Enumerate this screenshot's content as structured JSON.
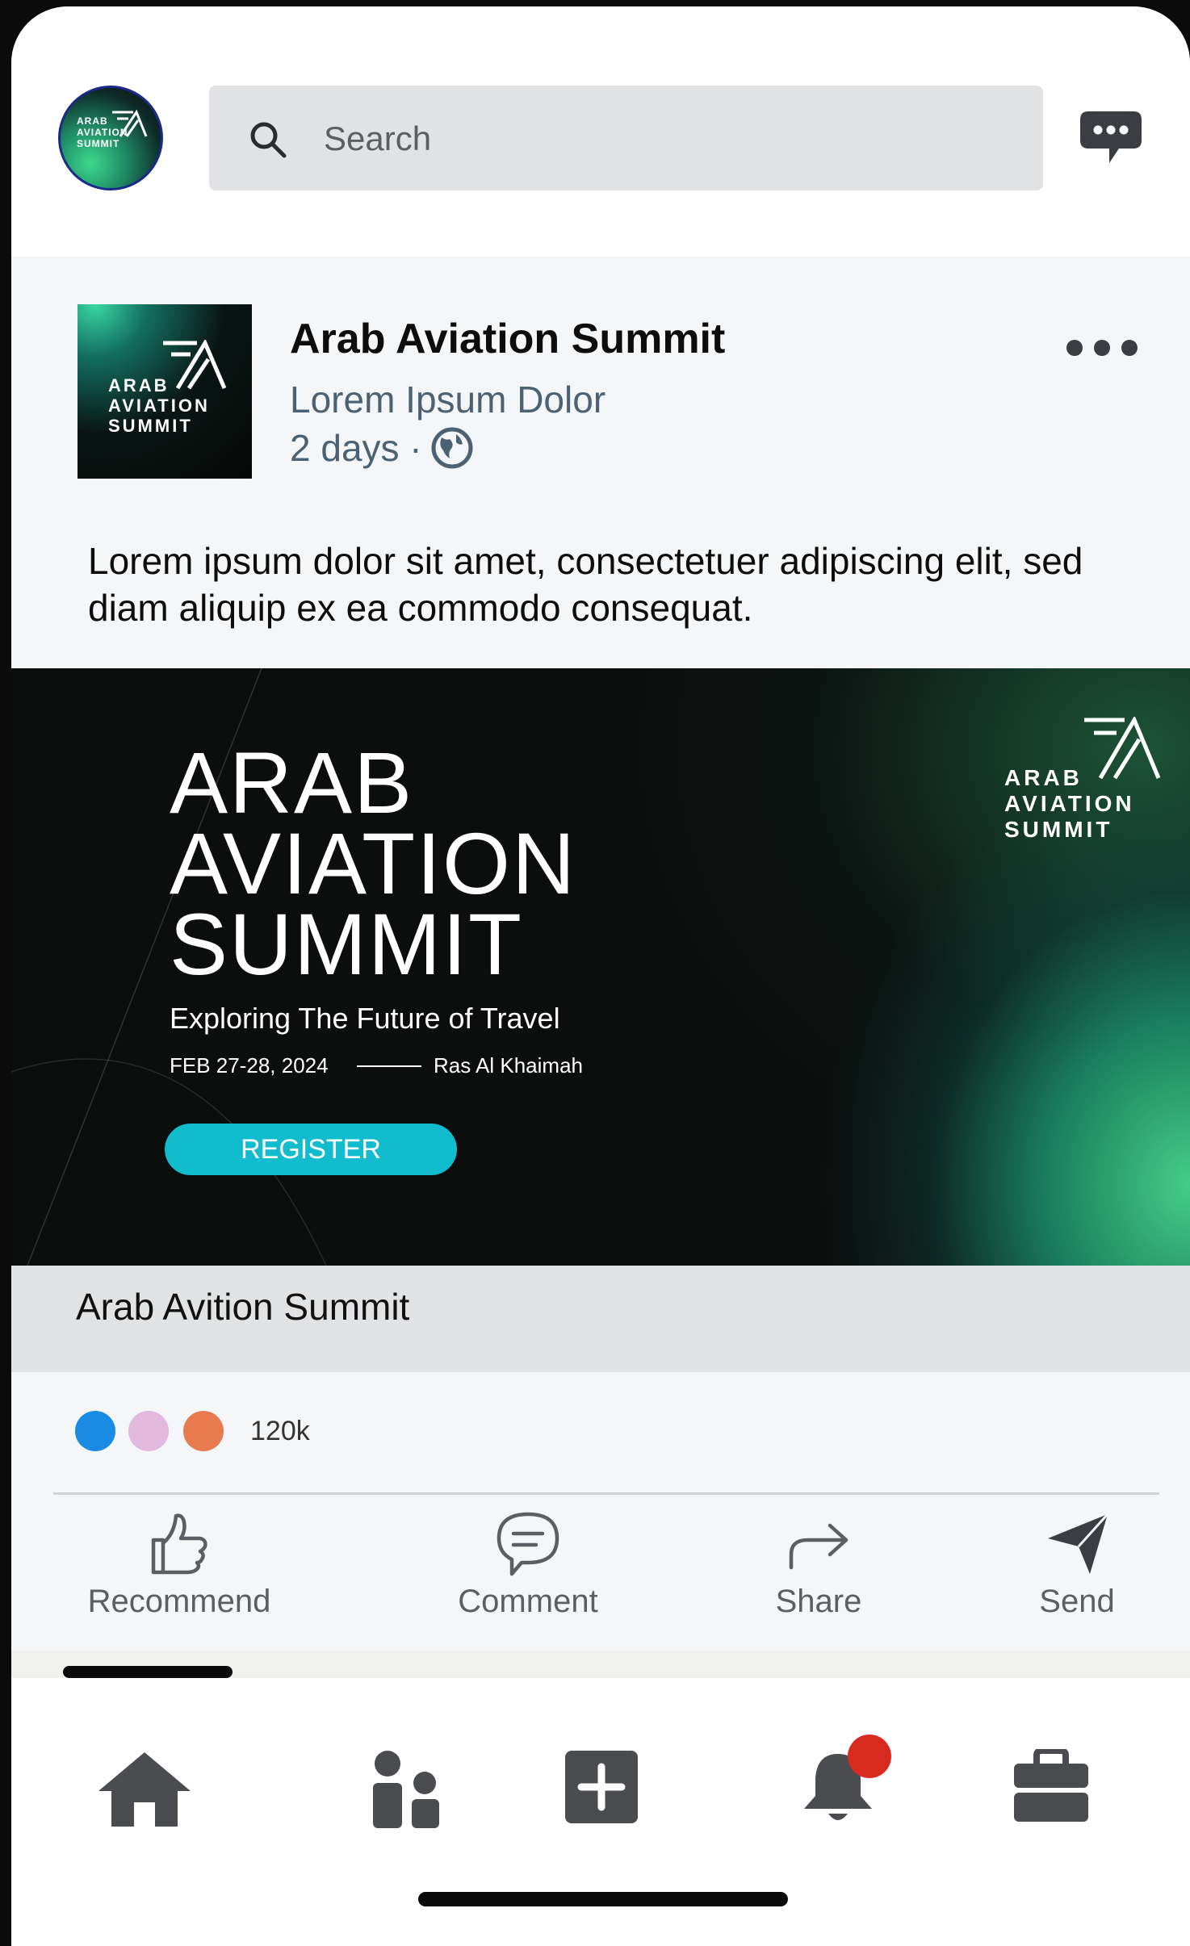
{
  "header": {
    "avatar_logo_text": [
      "ARAB",
      "AVIATION",
      "SUMMIT"
    ],
    "search_placeholder": "Search"
  },
  "post": {
    "author": "Arab Aviation Summit",
    "subtitle": "Lorem Ipsum Dolor",
    "time": "2 days ·",
    "text": "Lorem ipsum dolor sit amet, consectetuer adipiscing elit, sed diam aliquip ex ea commodo consequat.",
    "logo_text": [
      "ARAB",
      "AVIATION",
      "SUMMIT"
    ]
  },
  "banner": {
    "title_lines": [
      "ARAB",
      "AVIATION",
      "SUMMIT"
    ],
    "tagline": "Exploring The Future of Travel",
    "date": "FEB 27-28, 2024",
    "location": "Ras Al Khaimah",
    "register_label": "REGISTER",
    "logo_text": [
      "ARAB",
      "AVIATION",
      "SUMMIT"
    ]
  },
  "caption": "Arab Avition Summit",
  "reactions": {
    "count": "120k",
    "colors": [
      "#1a8be3",
      "#e2b8de",
      "#e97a4f"
    ]
  },
  "actions": [
    {
      "label": "Recommend",
      "icon": "thumbs-up-icon"
    },
    {
      "label": "Comment",
      "icon": "comment-icon"
    },
    {
      "label": "Share",
      "icon": "share-arrow-icon"
    },
    {
      "label": "Send",
      "icon": "send-icon"
    }
  ],
  "bottom_nav": [
    {
      "icon": "home-icon"
    },
    {
      "icon": "network-icon"
    },
    {
      "icon": "post-add-icon"
    },
    {
      "icon": "notifications-bell-icon",
      "badge": true
    },
    {
      "icon": "jobs-briefcase-icon"
    }
  ],
  "colors": {
    "accent_register": "#11bccf",
    "link_text": "#4a6273",
    "notification_badge": "#d72b1f"
  }
}
